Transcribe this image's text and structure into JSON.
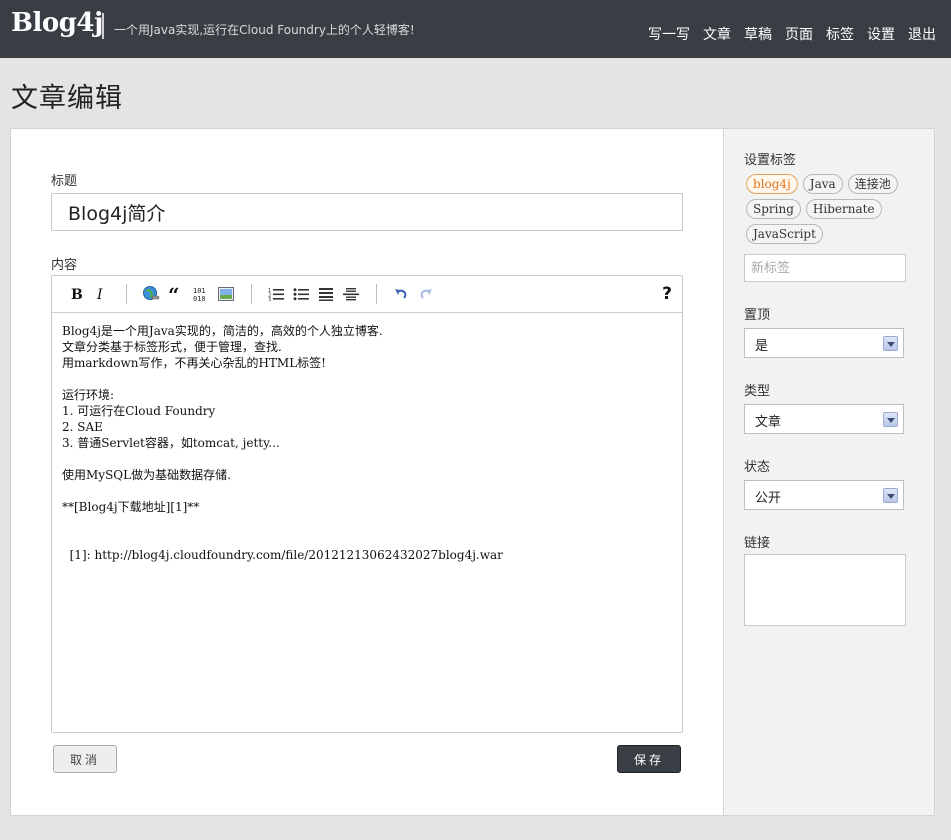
{
  "header": {
    "brand": "Blog4j",
    "tagline": "一个用Java实现,运行在Cloud Foundry上的个人轻博客!",
    "nav": [
      "写一写",
      "文章",
      "草稿",
      "页面",
      "标签",
      "设置",
      "退出"
    ]
  },
  "page_title": "文章编辑",
  "form": {
    "title_label": "标题",
    "title_value": "Blog4j简介",
    "content_label": "内容",
    "content_value": "Blog4j是一个用Java实现的，简洁的，高效的个人独立博客.\n文章分类基于标签形式，便于管理，查找.\n用markdown写作，不再关心杂乱的HTML标签!\n\n运行环境:\n1. 可运行在Cloud Foundry\n2. SAE\n3. 普通Servlet容器，如tomcat, jetty...\n\n使用MySQL做为基础数据存储.\n\n**[Blog4j下载地址][1]**\n\n\n  [1]: http://blog4j.cloudfoundry.com/file/20121213062432027blog4j.war",
    "help_label": "?",
    "cancel_label": "取消",
    "save_label": "保存"
  },
  "toolbar": {
    "icons": [
      "bold-icon",
      "italic-icon",
      "link-icon",
      "quote-icon",
      "code-icon",
      "image-icon",
      "ordered-list-icon",
      "unordered-list-icon",
      "heading-icon",
      "horizontal-rule-icon",
      "undo-icon",
      "redo-icon",
      "help-icon"
    ]
  },
  "sidebar": {
    "tags_label": "设置标签",
    "tags": [
      {
        "label": "blog4j",
        "active": true
      },
      {
        "label": "Java",
        "active": false
      },
      {
        "label": "连接池",
        "active": false
      },
      {
        "label": "Spring",
        "active": false
      },
      {
        "label": "Hibernate",
        "active": false
      },
      {
        "label": "JavaScript",
        "active": false
      }
    ],
    "new_tag_placeholder": "新标签",
    "top_label": "置顶",
    "top_value": "是",
    "type_label": "类型",
    "type_value": "文章",
    "status_label": "状态",
    "status_value": "公开",
    "link_label": "链接"
  },
  "colors": {
    "header_bg": "#393e44",
    "active_tag": "#e07a20",
    "save_bg": "#3a3f45"
  }
}
